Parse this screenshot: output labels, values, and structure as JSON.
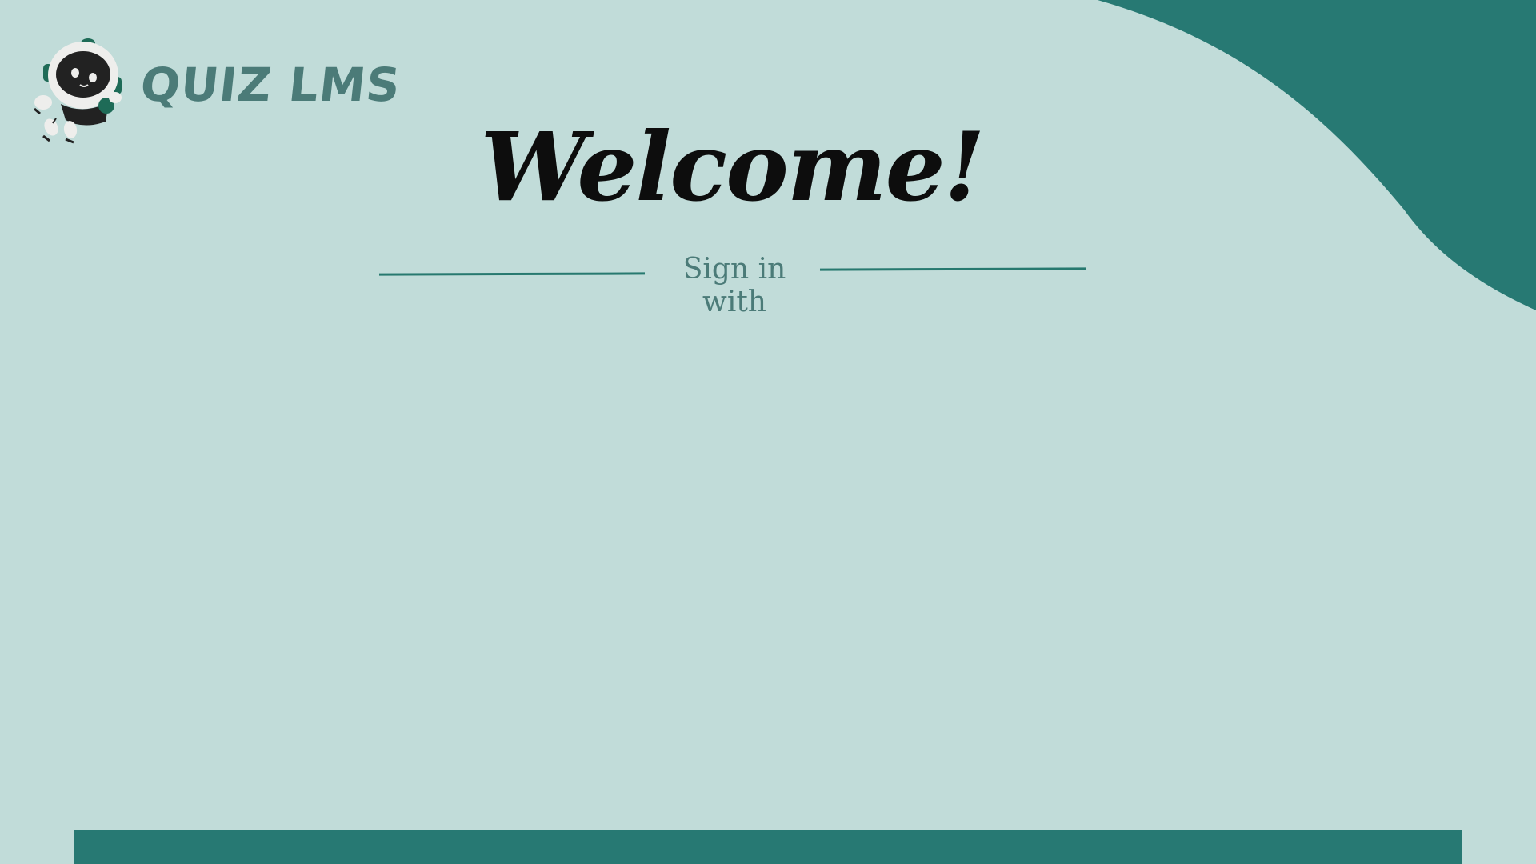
{
  "app": {
    "name": "QUIZ LMS"
  },
  "hero": {
    "title": "Welcome!",
    "subtitle": "Sign in with"
  },
  "colors": {
    "background": "#c1dcd9",
    "accent": "#277973",
    "muted_text": "#4b7b78",
    "title_text": "#0d0d0d"
  },
  "icons": {
    "logo": "robot-astronaut-mascot"
  }
}
